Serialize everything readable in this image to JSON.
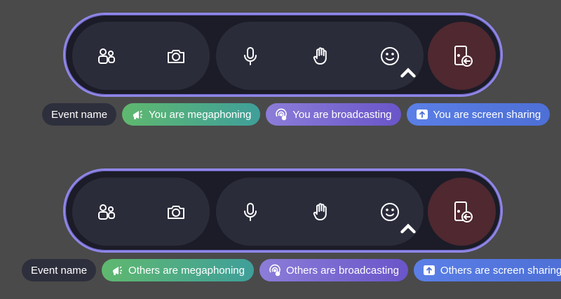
{
  "colors": {
    "background": "#4a4a4a",
    "bar_border": "#8f86e6",
    "leave_button": "#4f2830",
    "megaphone_chip": "#5fb86f",
    "broadcast_chip": "#7b6ad0",
    "screen_share_chip": "#5a7fe6",
    "event_chip": "#2e2f3d"
  },
  "toolbars": [
    {
      "buttons": {
        "people": "people-icon",
        "camera": "camera-icon",
        "mic": "microphone-icon",
        "hand": "raise-hand-icon",
        "reactions": "emoji-icon",
        "leave": "leave-icon"
      },
      "chips": {
        "event_name": "Event name",
        "megaphoning": "You are megaphoning",
        "broadcasting": "You are broadcasting",
        "screen_sharing": "You are screen sharing"
      }
    },
    {
      "buttons": {
        "people": "people-icon",
        "camera": "camera-icon",
        "mic": "microphone-icon",
        "hand": "raise-hand-icon",
        "reactions": "emoji-icon",
        "leave": "leave-icon"
      },
      "chips": {
        "event_name": "Event name",
        "megaphoning": "Others are megaphoning",
        "broadcasting": "Others are broadcasting",
        "screen_sharing": "Others are screen sharing"
      }
    }
  ]
}
